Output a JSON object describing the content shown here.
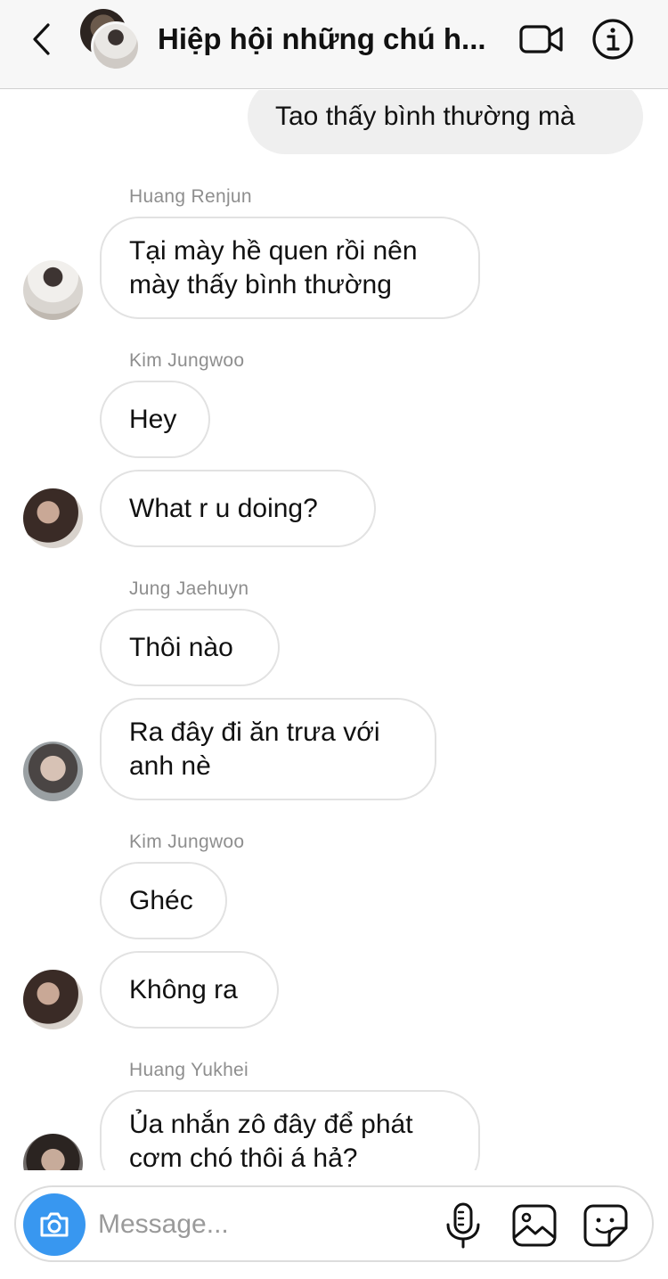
{
  "header": {
    "title": "Hiệp hội những chú h...",
    "back_icon": "chevron-left-icon",
    "video_icon": "video-camera-icon",
    "info_icon": "info-icon"
  },
  "messages": [
    {
      "direction": "outgoing",
      "text": "Tao thấy bình thường mà"
    },
    {
      "sender": "Huang Renjun",
      "text": "Tại mày hề quen rồi nên\nmày thấy bình thường"
    },
    {
      "sender": "Kim Jungwoo",
      "text": "Hey"
    },
    {
      "text": "What r u doing?"
    },
    {
      "sender": "Jung Jaehuyn",
      "text": "Thôi nào"
    },
    {
      "text": "Ra đây đi ăn trưa với\nanh nè"
    },
    {
      "sender": "Kim Jungwoo",
      "text": "Ghéc"
    },
    {
      "text": "Không ra"
    },
    {
      "sender": "Huang Yukhei",
      "text": "Ủa nhắn zô đây để phát\ncơm chó thôi á hả?"
    }
  ],
  "composer": {
    "placeholder": "Message...",
    "value": "",
    "camera_icon": "camera-icon",
    "mic_icon": "microphone-icon",
    "gallery_icon": "image-gallery-icon",
    "sticker_icon": "sticker-icon"
  },
  "colors": {
    "accent": "#3897f0",
    "incoming_border": "#e2e2e2",
    "outgoing_bg": "#efefef",
    "sender_label": "#8e8e8e"
  }
}
